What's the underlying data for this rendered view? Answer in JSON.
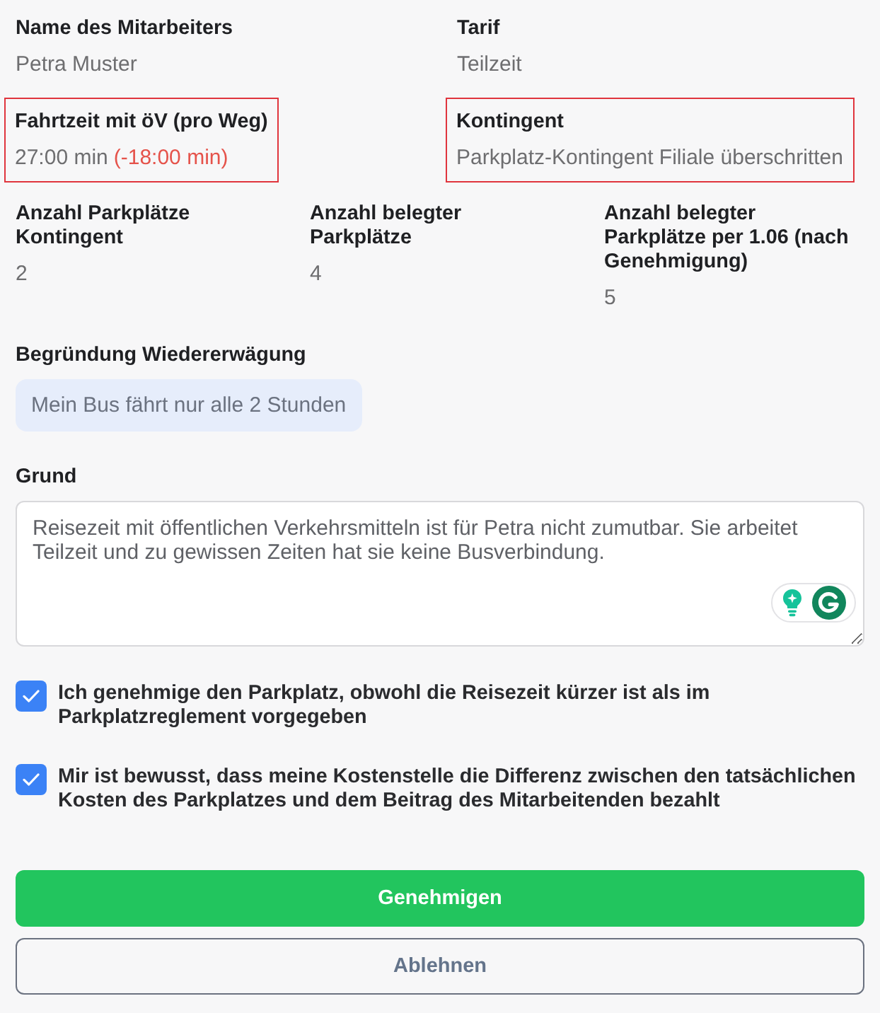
{
  "employee": {
    "fields": [
      {
        "label": "Name des Mitarbeiters",
        "value": "Petra Muster",
        "highlighted": false
      },
      {
        "label": "Tarif",
        "value": "Teilzeit",
        "highlighted": false
      },
      {
        "label": "Fahrtzeit mit öV (pro Weg)",
        "value": "27:00 min",
        "delta": "(-18:00 min)",
        "highlighted": true
      },
      {
        "label": "Kontingent",
        "value": "Parkplatz-Kontingent Filiale überschritten",
        "highlighted": true
      }
    ]
  },
  "parking": {
    "fields": [
      {
        "label": "Anzahl Parkplätze Kontingent",
        "value": "2"
      },
      {
        "label": "Anzahl belegter Parkplätze",
        "value": "4"
      },
      {
        "label": "Anzahl belegter Parkplätze per 1.06 (nach Genehmigung)",
        "value": "5"
      }
    ]
  },
  "reconsideration": {
    "label": "Begründung Wiedererwägung",
    "value": "Mein Bus fährt nur alle 2 Stunden"
  },
  "reason": {
    "label": "Grund",
    "value": "Reisezeit mit öffentlichen Verkehrsmitteln ist für Petra nicht zumutbar. Sie arbeitet Teilzeit und zu gewissen Zeiten hat sie keine Busverbindung."
  },
  "confirmations": [
    {
      "label": "Ich genehmige den Parkplatz, obwohl die Reisezeit kürzer ist als im Parkplatzreglement vorgegeben",
      "checked": true
    },
    {
      "label": "Mir ist bewusst, dass meine Kostenstelle die Differenz zwischen den tatsächlichen Kosten des Parkplatzes und dem Beitrag des Mitarbeitenden bezahlt",
      "checked": true
    }
  ],
  "buttons": [
    {
      "label": "Genehmigen",
      "kind": "primary"
    },
    {
      "label": "Ablehnen",
      "kind": "secondary"
    }
  ]
}
